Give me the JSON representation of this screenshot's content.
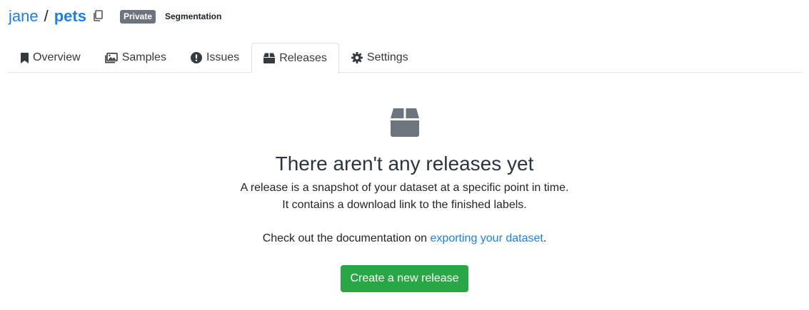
{
  "breadcrumb": {
    "owner": "jane",
    "separator": "/",
    "dataset": "pets"
  },
  "badges": {
    "visibility": "Private",
    "task": "Segmentation"
  },
  "tabs": [
    {
      "label": "Overview",
      "icon": "bookmark-icon"
    },
    {
      "label": "Samples",
      "icon": "images-icon"
    },
    {
      "label": "Issues",
      "icon": "exclamation-circle-icon"
    },
    {
      "label": "Releases",
      "icon": "box-icon",
      "active": true
    },
    {
      "label": "Settings",
      "icon": "gear-icon"
    }
  ],
  "empty_state": {
    "icon": "box-icon",
    "title": "There aren't any releases yet",
    "line1": "A release is a snapshot of your dataset at a specific point in time.",
    "line2": "It contains a download link to the finished labels.",
    "doc_prefix": "Check out the documentation on ",
    "doc_link": "exporting your dataset",
    "doc_suffix": ".",
    "button": "Create a new release"
  },
  "colors": {
    "link": "#1a7fe8",
    "primary_button": "#28a745",
    "badge_private": "#6c757d",
    "icon_gray": "#6c757d"
  }
}
